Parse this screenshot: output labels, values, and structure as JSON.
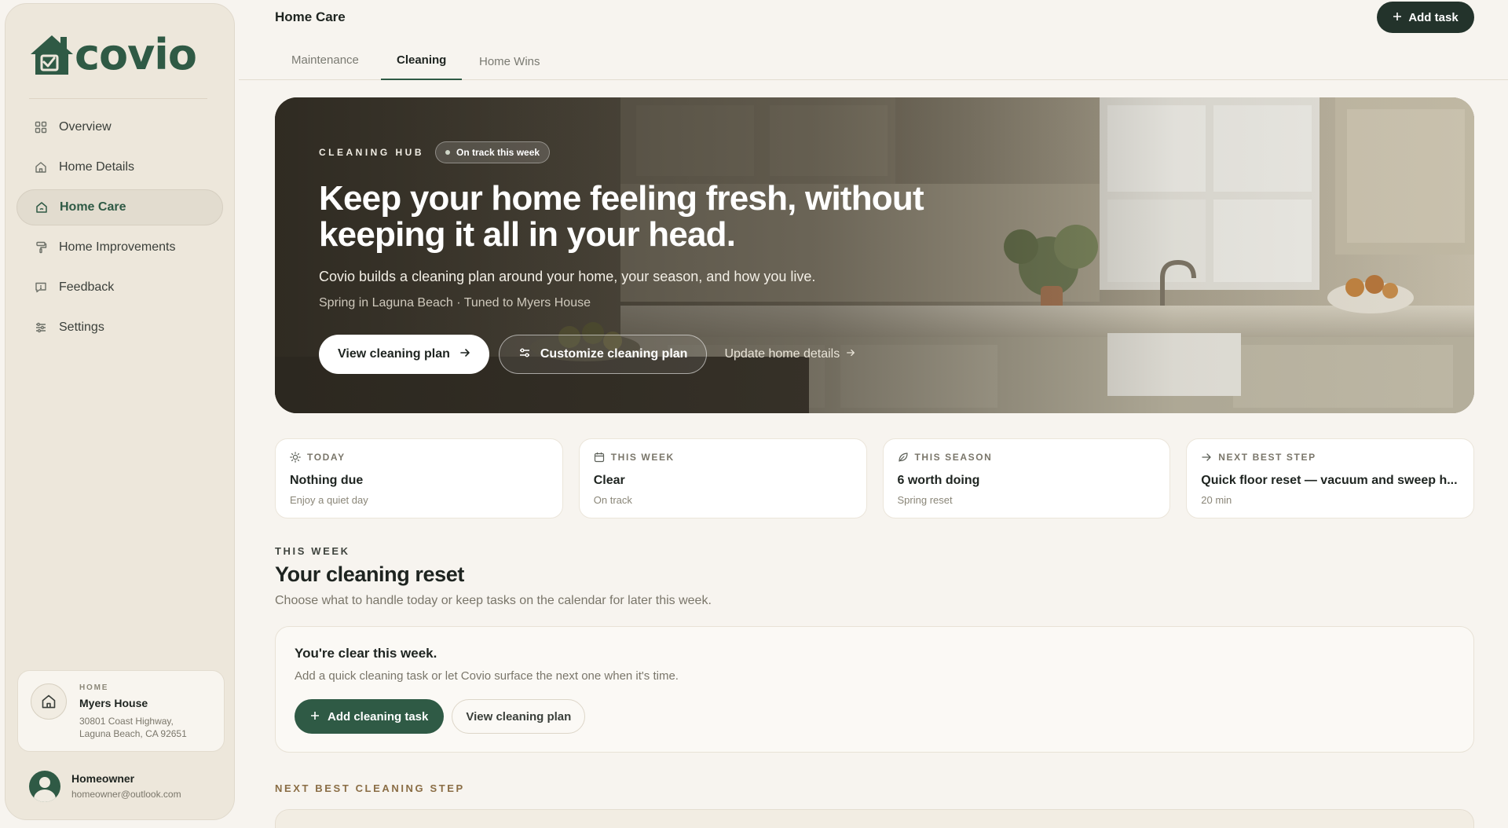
{
  "brand": {
    "name": "covio"
  },
  "sidebar": {
    "items": [
      {
        "label": "Overview",
        "icon": "grid-icon"
      },
      {
        "label": "Home Details",
        "icon": "house-icon"
      },
      {
        "label": "Home Care",
        "icon": "home-care-icon",
        "active": true
      },
      {
        "label": "Home Improvements",
        "icon": "paint-roller-icon"
      },
      {
        "label": "Feedback",
        "icon": "message-icon"
      },
      {
        "label": "Settings",
        "icon": "sliders-icon"
      }
    ],
    "home": {
      "kicker": "HOME",
      "name": "Myers House",
      "address_line1": "30801 Coast Highway,",
      "address_line2": "Laguna Beach, CA 92651"
    },
    "user": {
      "name": "Homeowner",
      "email": "homeowner@outlook.com"
    }
  },
  "header": {
    "title": "Home Care",
    "add_task_label": "Add task",
    "tabs": [
      {
        "label": "Maintenance"
      },
      {
        "label": "Cleaning",
        "active": true
      },
      {
        "label": "Home Wins"
      }
    ]
  },
  "hero": {
    "kicker": "CLEANING HUB",
    "badge": "On track this week",
    "title": "Keep your home feeling fresh, without keeping it all in your head.",
    "subtitle": "Covio builds a cleaning plan around your home, your season, and how you live.",
    "meta": "Spring in Laguna Beach · Tuned to Myers House",
    "primary_label": "View cleaning plan",
    "secondary_label": "Customize cleaning plan",
    "link_label": "Update home details"
  },
  "stats": [
    {
      "kicker": "TODAY",
      "icon": "sun-icon",
      "value": "Nothing due",
      "sub": "Enjoy a quiet day"
    },
    {
      "kicker": "THIS WEEK",
      "icon": "calendar-icon",
      "value": "Clear",
      "sub": "On track"
    },
    {
      "kicker": "THIS SEASON",
      "icon": "leaf-icon",
      "value": "6 worth doing",
      "sub": "Spring reset"
    },
    {
      "kicker": "NEXT BEST STEP",
      "icon": "arrow-right-icon",
      "value": "Quick floor reset — vacuum and sweep h...",
      "sub": "20 min"
    }
  ],
  "section": {
    "kicker": "THIS WEEK",
    "title": "Your cleaning reset",
    "description": "Choose what to handle today or keep tasks on the calendar for later this week."
  },
  "clear_card": {
    "title": "You're clear this week.",
    "description": "Add a quick cleaning task or let Covio surface the next one when it's time.",
    "add_label": "Add cleaning task",
    "view_label": "View cleaning plan"
  },
  "next_section": {
    "kicker": "NEXT BEST CLEANING STEP"
  },
  "colors": {
    "brand": "#2f5a45",
    "dark": "#23332b",
    "background": "#f7f4ef",
    "sidebar": "#ede7db"
  }
}
